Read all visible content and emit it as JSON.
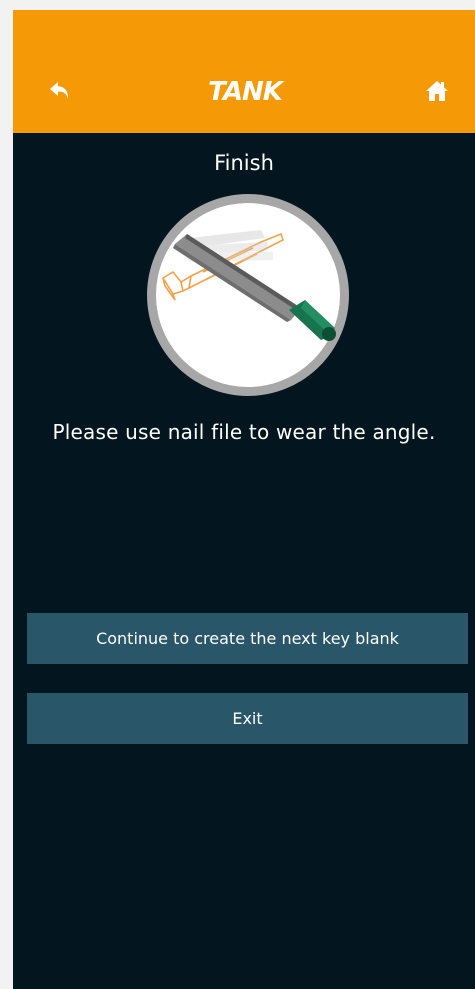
{
  "header": {
    "brand": "TANK",
    "back_icon": "back-arrow-icon",
    "home_icon": "home-icon"
  },
  "page": {
    "title": "Finish",
    "instruction": "Please use nail file to wear the angle.",
    "illustration": "nail-file-on-key-illustration"
  },
  "actions": {
    "continue_label": "Continue to create the next key blank",
    "exit_label": "Exit"
  },
  "colors": {
    "header": "#f59a06",
    "background": "#031620",
    "button": "#295668",
    "text": "#ffffff"
  }
}
